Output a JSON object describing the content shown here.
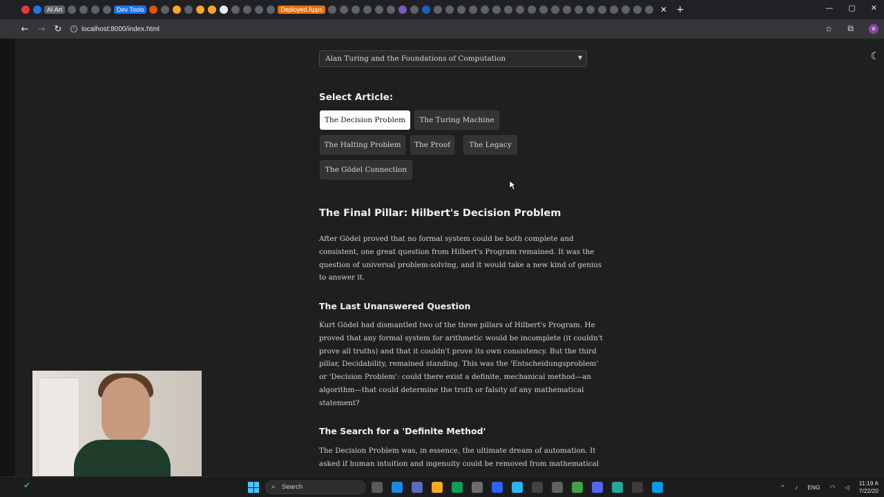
{
  "browser": {
    "tab_chips": [
      "AI Art",
      "Dev Tools",
      "Deployed Apps"
    ],
    "url": "localhost:8000/index.html",
    "profile_initial": "e"
  },
  "page": {
    "topic_select_value": "Alan Turing and the Foundations of Computation",
    "select_article_label": "Select Article:",
    "articles": [
      "The Decision Problem",
      "The Turing Machine",
      "The Halting Problem",
      "The Proof",
      "The Legacy",
      "The Gödel Connection"
    ],
    "active_article": "The Decision Problem",
    "main_heading": "The Final Pillar: Hilbert's Decision Problem",
    "intro_lines": [
      "After Gödel proved that no formal system could be both complete and",
      "consistent, one great question from Hilbert's Program remained. It was the",
      "question of universal problem-solving, and it would take a new kind of genius",
      "to answer it."
    ],
    "section1_heading": "The Last Unanswered Question",
    "section1_lines": [
      "Kurt Gödel had dismantled two of the three pillars of Hilbert's Program. He",
      "proved that any formal system for arithmetic would be incomplete (it couldn't",
      "prove all truths) and that it couldn't prove its own consistency. But the third",
      "pillar, Decidability, remained standing. This was the 'Entscheidungsproblem'",
      "or 'Decision Problem': could there exist a definite, mechanical method—an",
      "algorithm—that could determine the truth or falsity of any mathematical",
      "statement?"
    ],
    "section2_heading": "The Search for a 'Definite Method'",
    "section2_lines": [
      "The Decision Problem was, in essence, the ultimate dream of automation. It",
      "asked if human intuition and ingenuity could be removed from mathematical"
    ]
  },
  "taskbar": {
    "search_placeholder": "Search",
    "language": "ENG",
    "time": "11:19 A",
    "date": "7/22/20"
  },
  "colors": {
    "page_bg": "#1f1f1f",
    "active_button_bg": "#ffffff",
    "button_bg": "#333333"
  }
}
